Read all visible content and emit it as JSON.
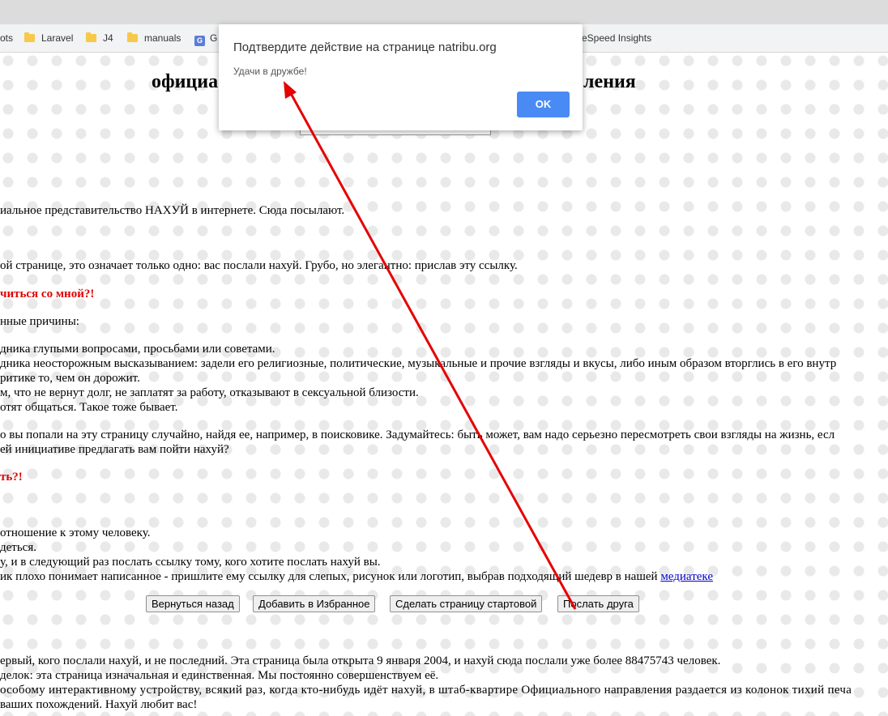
{
  "bookmarks": [
    {
      "icon": "folder-icon",
      "label": "ots"
    },
    {
      "icon": "folder-icon",
      "label": "Laravel"
    },
    {
      "icon": "folder-icon",
      "label": "J4"
    },
    {
      "icon": "folder-icon",
      "label": "manuals"
    },
    {
      "icon": "google-icon",
      "label": "G"
    },
    {
      "icon": "none",
      "label": "eSpeed Insights"
    }
  ],
  "page": {
    "title_left": "официа",
    "title_right": "ления",
    "intro_line": "иальное представительство НАХУЙ в интернете. Сюда посылают.",
    "line_sent": "ой странице, это означает только одно: вас послали нахуй. Грубо, но элегантно: прислав эту ссылку.",
    "red_heading_1": "читься со мной?!",
    "reasons_intro": "нные причины:",
    "reasons": [
      "дника глупыми вопросами, просьбами или советами.",
      "дника неосторожным высказыванием: задели его религиозные, политические, музыкальные и прочие взгляды и вкусы, либо иным образом вторглись в его внутр",
      "ритике то, чем он дорожит.",
      "м, что не вернут долг, не заплатят за работу, отказывают в сексуальной близости.",
      "отят общаться. Такое тоже бывает."
    ],
    "accident_line_1": "о вы попали на эту страницу случайно, найдя ее, например, в поисковике. Задумайтесь: быть может, вам надо серьезно пересмотреть свои взгляды на жизнь, есл",
    "accident_line_2": "ей инициативе предлагать вам пойти нахуй?",
    "red_heading_2": "ть?!",
    "advice": [
      "отношение к этому человеку.",
      "деться.",
      "у, и в следующий раз послать ссылку тому, кого хотите послать нахуй вы.",
      "ик плохо понимает написанное - пришлите ему ссылку для слепых, рисунок или логотип, выбрав подходящий шедевр в нашей "
    ],
    "media_link": "медиатеке",
    "buttons": {
      "back": "Вернуться назад",
      "favorites": "Добавить в Избранное",
      "homepage": "Сделать страницу стартовой",
      "send_friend": "Послать друга"
    },
    "footer": [
      "ервый, кого послали нахуй, и не последний. Эта страница была открыта 9 января 2004, и нахуй сюда послали уже более 88475743 человек.",
      "делок: эта страница изначальная и единственная. Мы постоянно совершенствуем её.",
      "особому интерактивному устройству, всякий раз, когда кто-нибудь идёт нахуй, в штаб-квартире Официального направления раздается из колонок тихий печа",
      "ваших похождений. Нахуй любит вас!"
    ]
  },
  "dialog": {
    "title": "Подтвердите действие на странице natribu.org",
    "message": "Удачи в дружбе!",
    "ok_label": "OK"
  },
  "colors": {
    "accent": "#4a8af4",
    "red_text": "#e00000",
    "arrow": "#e60000",
    "link": "#0000cc"
  }
}
